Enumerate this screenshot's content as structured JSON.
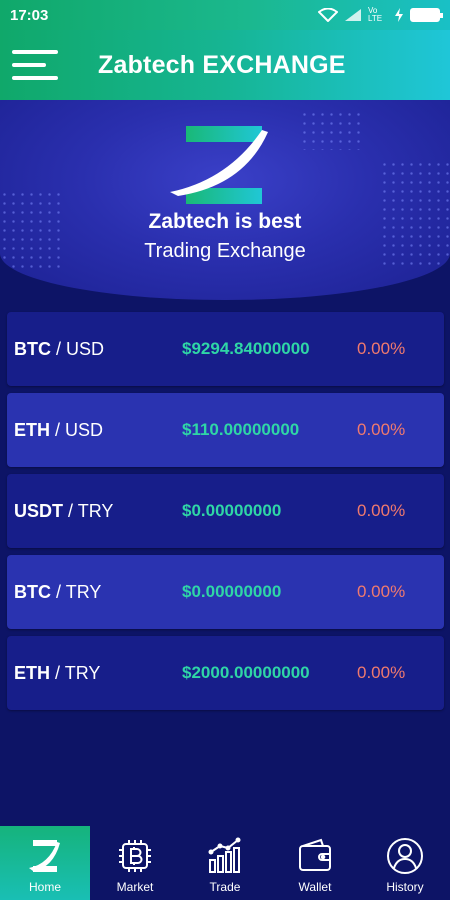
{
  "status": {
    "time": "17:03",
    "network": "Vo LTE"
  },
  "app": {
    "title": "Zabtech EXCHANGE"
  },
  "hero": {
    "title": "Zabtech is best",
    "subtitle": "Trading Exchange"
  },
  "pairs": [
    {
      "base": "BTC",
      "quote": "/ USD",
      "price": "$9294.84000000",
      "change": "0.00%"
    },
    {
      "base": "ETH",
      "quote": "/ USD",
      "price": "$110.00000000",
      "change": "0.00%"
    },
    {
      "base": "USDT",
      "quote": "/ TRY",
      "price": "$0.00000000",
      "change": "0.00%"
    },
    {
      "base": "BTC",
      "quote": "/ TRY",
      "price": "$0.00000000",
      "change": "0.00%"
    },
    {
      "base": "ETH",
      "quote": "/ TRY",
      "price": "$2000.00000000",
      "change": "0.00%"
    }
  ],
  "nav": {
    "home": "Home",
    "market": "Market",
    "trade": "Trade",
    "wallet": "Wallet",
    "history": "History"
  },
  "colors": {
    "accent_green": "#16b37c",
    "accent_cyan": "#1fc6d8",
    "price_green": "#2fd6a6",
    "change_red": "#f07a6e",
    "background": "#0d1466"
  },
  "icons": {
    "menu": "hamburger-icon",
    "home": "z-logo-icon",
    "market": "bitcoin-chip-icon",
    "trade": "bar-chart-icon",
    "wallet": "wallet-icon",
    "history": "user-circle-icon"
  }
}
